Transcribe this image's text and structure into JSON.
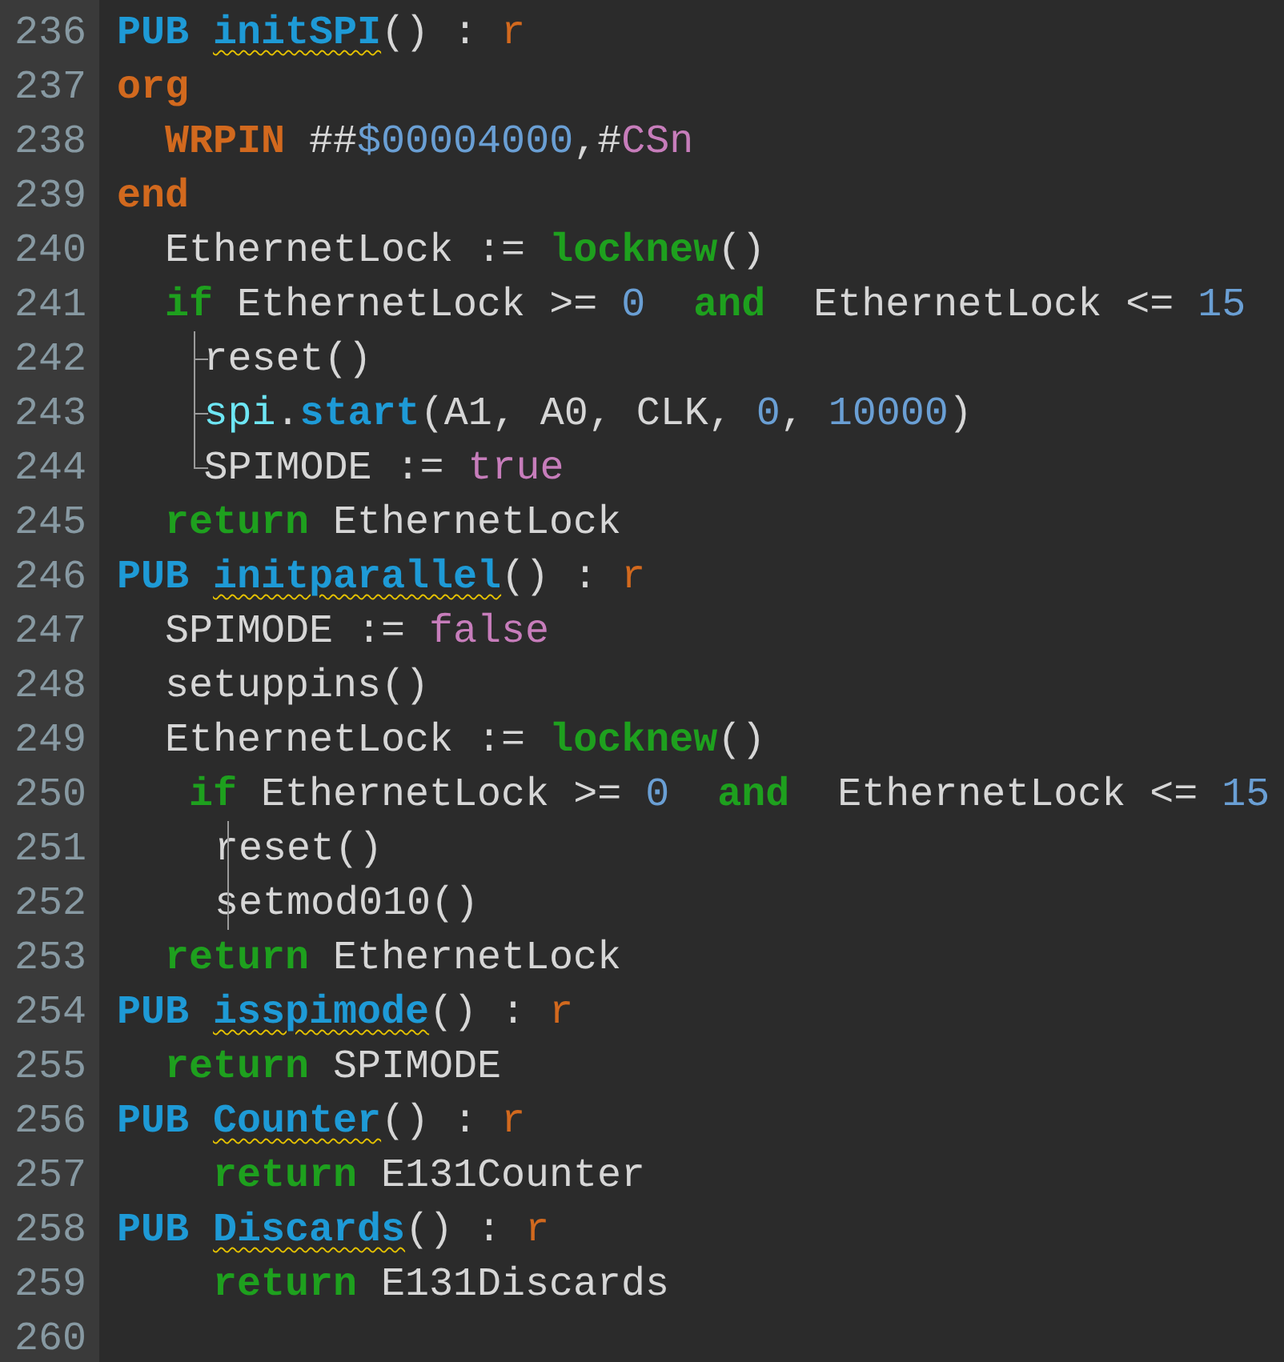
{
  "editor": {
    "lines": [
      {
        "number": "236",
        "tokens": [
          {
            "kind": "kw",
            "text": "PUB "
          },
          {
            "kind": "fn",
            "text": "initSPI",
            "warning": true
          },
          {
            "kind": "plain",
            "text": "() : "
          },
          {
            "kind": "result",
            "text": "r"
          }
        ]
      },
      {
        "number": "237",
        "tokens": [
          {
            "kind": "asm",
            "text": "org"
          }
        ]
      },
      {
        "number": "238",
        "tokens": [
          {
            "kind": "asm",
            "text": "  WRPIN"
          },
          {
            "kind": "plain",
            "text": " ##"
          },
          {
            "kind": "num",
            "text": "$00004000"
          },
          {
            "kind": "plain",
            "text": ",#"
          },
          {
            "kind": "const",
            "text": "CSn"
          }
        ]
      },
      {
        "number": "239",
        "tokens": [
          {
            "kind": "asm",
            "text": "end"
          }
        ]
      },
      {
        "number": "240",
        "tokens": [
          {
            "kind": "plain",
            "text": "  EthernetLock := "
          },
          {
            "kind": "flow",
            "text": "locknew"
          },
          {
            "kind": "plain",
            "text": "()"
          }
        ]
      },
      {
        "number": "241",
        "tokens": [
          {
            "kind": "flow",
            "text": "  if"
          },
          {
            "kind": "plain",
            "text": " EthernetLock >= "
          },
          {
            "kind": "num",
            "text": "0  "
          },
          {
            "kind": "flow",
            "text": "and"
          },
          {
            "kind": "plain",
            "text": "  EthernetLock <= "
          },
          {
            "kind": "num",
            "text": "15"
          }
        ]
      },
      {
        "number": "242",
        "kind": "branch",
        "tokens": [
          {
            "kind": "plain",
            "text": "   reset()"
          }
        ]
      },
      {
        "number": "243",
        "kind": "branch",
        "tokens": [
          {
            "kind": "obj",
            "text": "   spi"
          },
          {
            "kind": "plain",
            "text": "."
          },
          {
            "kind": "method",
            "text": "start"
          },
          {
            "kind": "plain",
            "text": "(A1, A0, CLK, "
          },
          {
            "kind": "num",
            "text": "0"
          },
          {
            "kind": "plain",
            "text": ", "
          },
          {
            "kind": "num",
            "text": "10000"
          },
          {
            "kind": "plain",
            "text": ")"
          }
        ]
      },
      {
        "number": "244",
        "kind": "last",
        "tokens": [
          {
            "kind": "plain",
            "text": "   SPIMODE := "
          },
          {
            "kind": "const",
            "text": "true"
          }
        ]
      },
      {
        "number": "245",
        "tokens": [
          {
            "kind": "flow",
            "text": "  return"
          },
          {
            "kind": "plain",
            "text": " EthernetLock"
          }
        ]
      },
      {
        "number": "246",
        "tokens": [
          {
            "kind": "kw",
            "text": "PUB "
          },
          {
            "kind": "fn",
            "text": "initparallel",
            "warning": true
          },
          {
            "kind": "plain",
            "text": "() : "
          },
          {
            "kind": "result",
            "text": "r"
          }
        ]
      },
      {
        "number": "247",
        "tokens": [
          {
            "kind": "plain",
            "text": "  SPIMODE := "
          },
          {
            "kind": "const",
            "text": "false"
          }
        ]
      },
      {
        "number": "248",
        "tokens": [
          {
            "kind": "plain",
            "text": "  setuppins()"
          }
        ]
      },
      {
        "number": "249",
        "tokens": [
          {
            "kind": "plain",
            "text": "  EthernetLock := "
          },
          {
            "kind": "flow",
            "text": "locknew"
          },
          {
            "kind": "plain",
            "text": "()"
          }
        ]
      },
      {
        "number": "250",
        "tokens": [
          {
            "kind": "flow",
            "text": "   if"
          },
          {
            "kind": "plain",
            "text": " EthernetLock >= "
          },
          {
            "kind": "num",
            "text": "0  "
          },
          {
            "kind": "flow",
            "text": "and"
          },
          {
            "kind": "plain",
            "text": "  EthernetLock <= "
          },
          {
            "kind": "num",
            "text": "15"
          }
        ]
      },
      {
        "number": "251",
        "kind": "bar",
        "tokens": [
          {
            "kind": "plain",
            "text": "    reset()"
          }
        ]
      },
      {
        "number": "252",
        "kind": "bar",
        "tokens": [
          {
            "kind": "plain",
            "text": "    setmod010()"
          }
        ]
      },
      {
        "number": "253",
        "tokens": [
          {
            "kind": "flow",
            "text": "  return"
          },
          {
            "kind": "plain",
            "text": " EthernetLock"
          }
        ]
      },
      {
        "number": "254",
        "tokens": [
          {
            "kind": "kw",
            "text": "PUB "
          },
          {
            "kind": "fn",
            "text": "isspimode",
            "warning": true
          },
          {
            "kind": "plain",
            "text": "() : "
          },
          {
            "kind": "result",
            "text": "r"
          }
        ]
      },
      {
        "number": "255",
        "tokens": [
          {
            "kind": "flow",
            "text": "  return"
          },
          {
            "kind": "plain",
            "text": " SPIMODE"
          }
        ]
      },
      {
        "number": "256",
        "tokens": [
          {
            "kind": "kw",
            "text": "PUB "
          },
          {
            "kind": "fn",
            "text": "Counter",
            "warning": true
          },
          {
            "kind": "plain",
            "text": "() : "
          },
          {
            "kind": "result",
            "text": "r"
          }
        ]
      },
      {
        "number": "257",
        "tokens": [
          {
            "kind": "flow",
            "text": "    return"
          },
          {
            "kind": "plain",
            "text": " E131Counter"
          }
        ]
      },
      {
        "number": "258",
        "tokens": [
          {
            "kind": "kw",
            "text": "PUB "
          },
          {
            "kind": "fn",
            "text": "Discards",
            "warning": true
          },
          {
            "kind": "plain",
            "text": "() : "
          },
          {
            "kind": "result",
            "text": "r"
          }
        ]
      },
      {
        "number": "259",
        "tokens": [
          {
            "kind": "flow",
            "text": "    return"
          },
          {
            "kind": "plain",
            "text": " E131Discards"
          }
        ]
      },
      {
        "number": "260"
      }
    ]
  }
}
